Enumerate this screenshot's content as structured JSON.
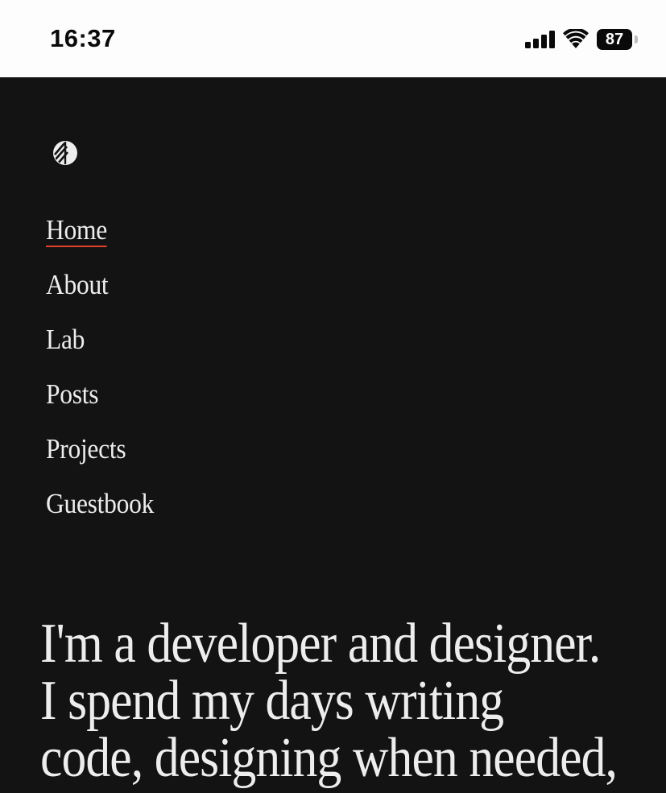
{
  "status_bar": {
    "time": "16:37",
    "battery_level": "87",
    "icons": [
      "signal-icon",
      "wifi-icon",
      "battery-icon"
    ]
  },
  "site": {
    "logo_icon": "striped-circle-logo-icon",
    "accent_color": "#e0412a",
    "background_color": "#131313",
    "text_color": "#ededed"
  },
  "nav": {
    "active": "Home",
    "items": [
      {
        "label": "Home"
      },
      {
        "label": "About"
      },
      {
        "label": "Lab"
      },
      {
        "label": "Posts"
      },
      {
        "label": "Projects"
      },
      {
        "label": "Guestbook"
      }
    ]
  },
  "hero": {
    "lines": [
      "I'm a developer and designer.",
      "I spend my days writing",
      "code, designing when needed,"
    ]
  }
}
